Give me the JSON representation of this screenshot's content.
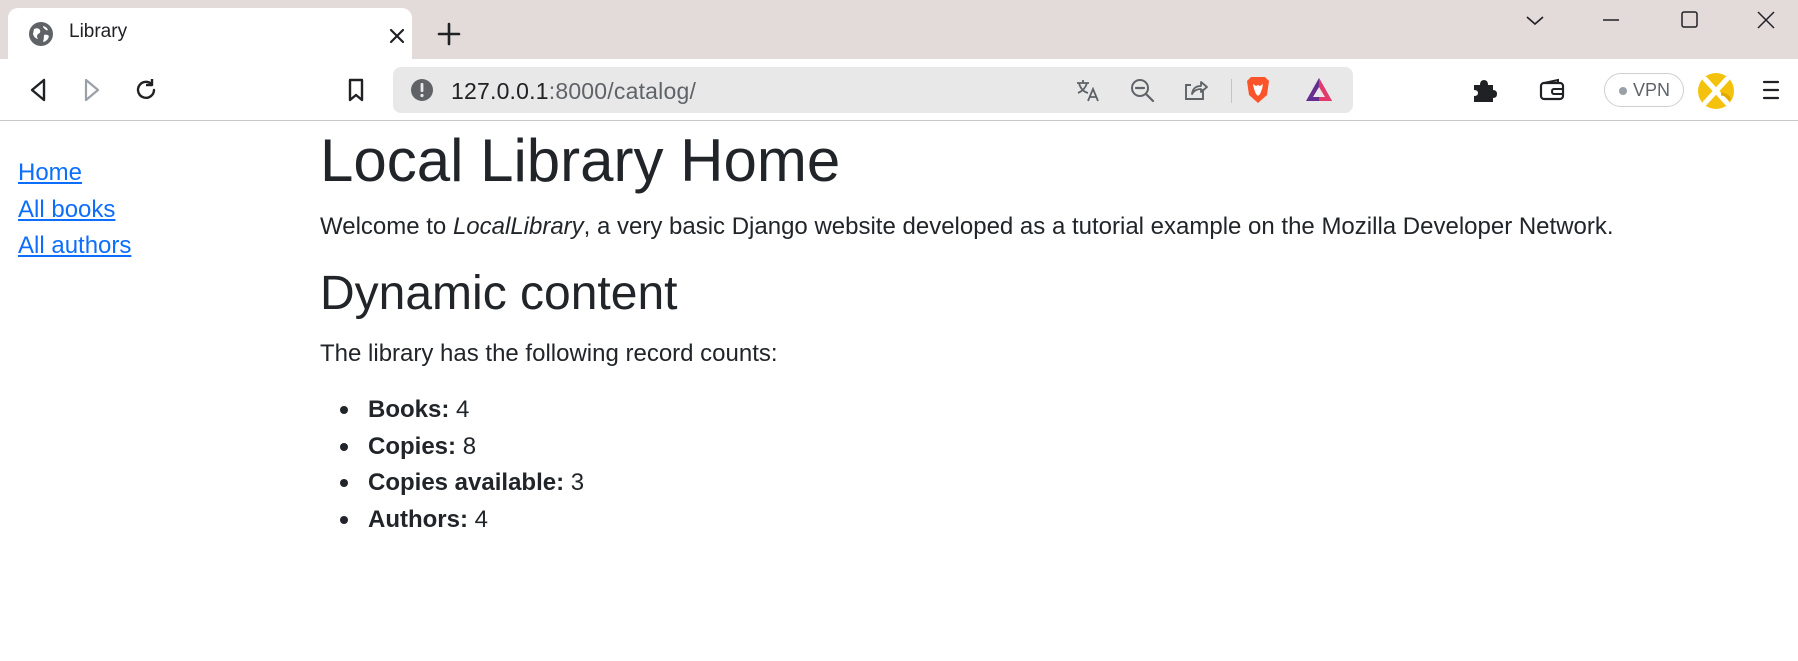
{
  "browser": {
    "tab": {
      "title": "Library"
    },
    "url": {
      "host": "127.0.0.1",
      "rest": ":8000/catalog/"
    },
    "vpn_label": "VPN",
    "icons": [
      "globe-icon",
      "close-icon",
      "plus-icon",
      "chevron-down-icon",
      "minimize-icon",
      "maximize-icon",
      "window-close-icon",
      "back-icon",
      "forward-icon",
      "reload-icon",
      "bookmark-icon",
      "info-icon",
      "translate-icon",
      "zoom-out-icon",
      "share-icon",
      "brave-shield-icon",
      "brave-rewards-icon",
      "extensions-icon",
      "wallet-icon",
      "menu-icon"
    ]
  },
  "sidebar": {
    "links": [
      {
        "label": "Home"
      },
      {
        "label": "All books"
      },
      {
        "label": "All authors"
      }
    ]
  },
  "main": {
    "title": "Local Library Home",
    "welcome": {
      "prefix": "Welcome to ",
      "emphasis": "LocalLibrary",
      "suffix": ", a very basic Django website developed as a tutorial example on the Mozilla Developer Network."
    },
    "section_title": "Dynamic content",
    "counts_intro": "The library has the following record counts:",
    "counts": [
      {
        "label": "Books:",
        "value": "4"
      },
      {
        "label": "Copies:",
        "value": "8"
      },
      {
        "label": "Copies available:",
        "value": "3"
      },
      {
        "label": "Authors:",
        "value": "4"
      }
    ]
  },
  "colors": {
    "tabstrip_bg": "#e3dada",
    "link": "#0d6efd",
    "text": "#212529",
    "brave_orange": "#fb542b",
    "rewards_purple": "#662d91"
  }
}
